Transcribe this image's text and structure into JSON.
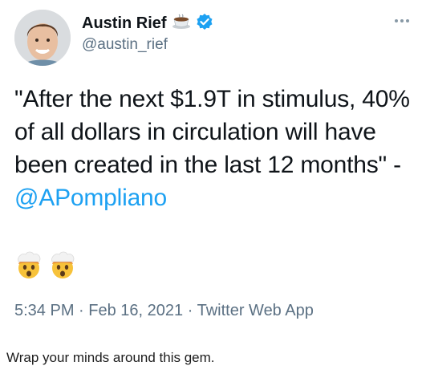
{
  "tweet": {
    "display_name": "Austin Rief",
    "name_emoji": "coffee-cup-icon",
    "verified": true,
    "handle": "@austin_rief",
    "text_before": "\"After the next $1.9T in stimulus, 40% of all dollars in circulation will have been created in the last 12 months\" - ",
    "mention": "@APompliano",
    "emojis": [
      "exploding-head-icon",
      "exploding-head-icon"
    ],
    "time": "5:34 PM",
    "separator": "·",
    "date": "Feb 16, 2021",
    "source": "Twitter Web App",
    "colors": {
      "mention": "#1da1f2",
      "verified": "#1da1f2",
      "meta": "#5b7083"
    }
  },
  "post": {
    "caption": "Wrap your minds around this gem."
  }
}
